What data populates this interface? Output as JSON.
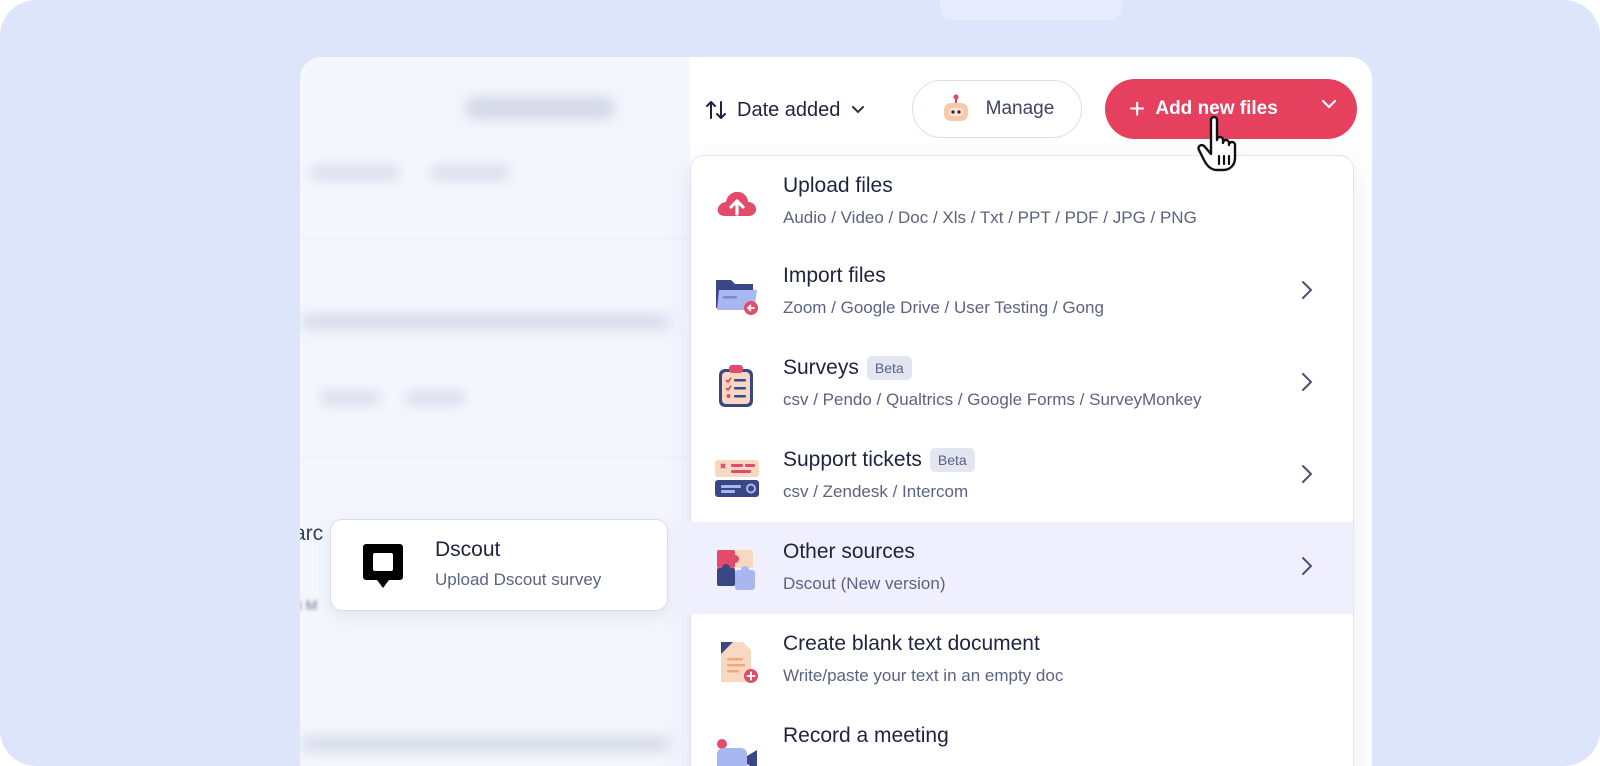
{
  "toolbar": {
    "sort_label": "Date added",
    "manage_label": "Manage",
    "add_label": "Add new files"
  },
  "menu": {
    "items": [
      {
        "title": "Upload files",
        "subtitle": "Audio / Video / Doc / Xls / Txt / PPT / PDF / JPG / PNG",
        "badge": ""
      },
      {
        "title": "Import files",
        "subtitle": "Zoom / Google Drive / User Testing / Gong",
        "badge": ""
      },
      {
        "title": "Surveys",
        "subtitle": "csv / Pendo / Qualtrics / Google Forms / SurveyMonkey",
        "badge": "Beta"
      },
      {
        "title": "Support tickets",
        "subtitle": "csv / Zendesk / Intercom",
        "badge": "Beta"
      },
      {
        "title": "Other sources",
        "subtitle": "Dscout (New version)",
        "badge": ""
      },
      {
        "title": "Create blank text document",
        "subtitle": "Write/paste your text in an empty doc",
        "badge": ""
      },
      {
        "title": "Record a meeting",
        "subtitle": "",
        "badge": ""
      }
    ]
  },
  "submenu": {
    "title": "Dscout",
    "subtitle": "Upload Dscout survey"
  },
  "background": {
    "partial_text": "arc",
    "partial_small": "ri M"
  },
  "colors": {
    "frame_bg": "#dde5fb",
    "accent": "#e6405f",
    "highlight": "#efeffd",
    "badge_bg": "#e3e6f1"
  },
  "icons": {
    "sort": "sort-arrows-icon",
    "manage": "robot-icon",
    "add": "plus-icon",
    "upload": "cloud-upload-icon",
    "import": "folder-import-icon",
    "surveys": "clipboard-icon",
    "tickets": "ticket-icon",
    "other": "puzzle-icon",
    "blank": "document-add-icon",
    "record": "video-camera-icon",
    "dscout": "dscout-logo-icon",
    "cursor": "hand-pointer-icon"
  }
}
